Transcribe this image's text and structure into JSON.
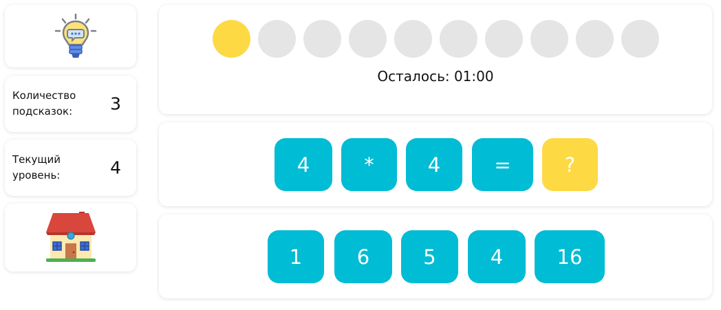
{
  "sidebar": {
    "hint_icon": "lightbulb-icon",
    "hints": {
      "label": "Количество подсказок:",
      "value": "3"
    },
    "level": {
      "label": "Текущий уровень:",
      "value": "4"
    },
    "home_icon": "house-icon"
  },
  "progress": {
    "total_steps": 10,
    "completed_steps": 1,
    "active_color": "#fdd944",
    "inactive_color": "#e6e5e5",
    "timer_text": "Осталось: 01:00"
  },
  "equation": {
    "tokens": [
      "4",
      "*",
      "4",
      "=",
      "?"
    ]
  },
  "answers": {
    "options": [
      "1",
      "6",
      "5",
      "4",
      "16"
    ]
  },
  "colors": {
    "tile": "#00bcd4",
    "question_tile": "#fdd944"
  }
}
